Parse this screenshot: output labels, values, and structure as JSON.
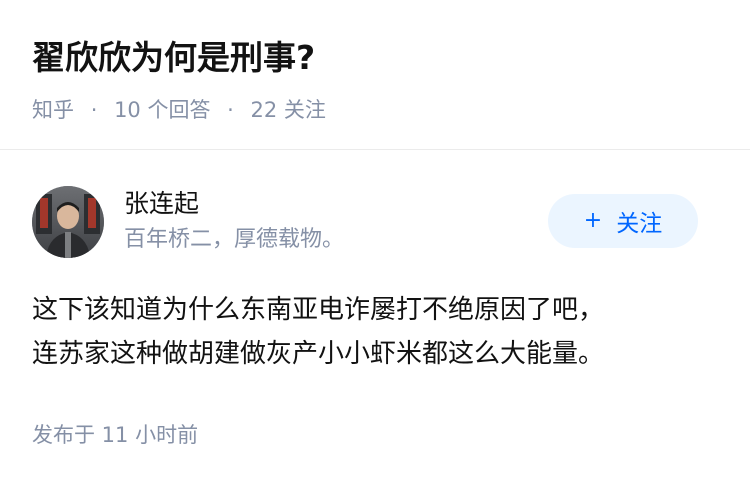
{
  "question": {
    "title": "翟欣欣为何是刑事?",
    "meta": {
      "source": "知乎",
      "separator": "·",
      "answer_count": "10 个回答",
      "follower_count": "22 关注"
    }
  },
  "answer": {
    "author": {
      "name": "张连起",
      "bio": "百年桥二，厚德载物。",
      "avatar_icon": "person-avatar"
    },
    "follow_button": {
      "icon": "+",
      "label": "关注"
    },
    "content": [
      "这下该知道为什么东南亚电诈屡打不绝原因了吧，",
      "连苏家这种做胡建做灰产小小虾米都这么大能量。"
    ],
    "publish_time": "发布于 11 小时前"
  },
  "colors": {
    "text_primary": "#121212",
    "text_secondary": "#8590a6",
    "accent": "#0066ff",
    "accent_bg": "#ebf5ff",
    "divider": "#ebebeb"
  }
}
